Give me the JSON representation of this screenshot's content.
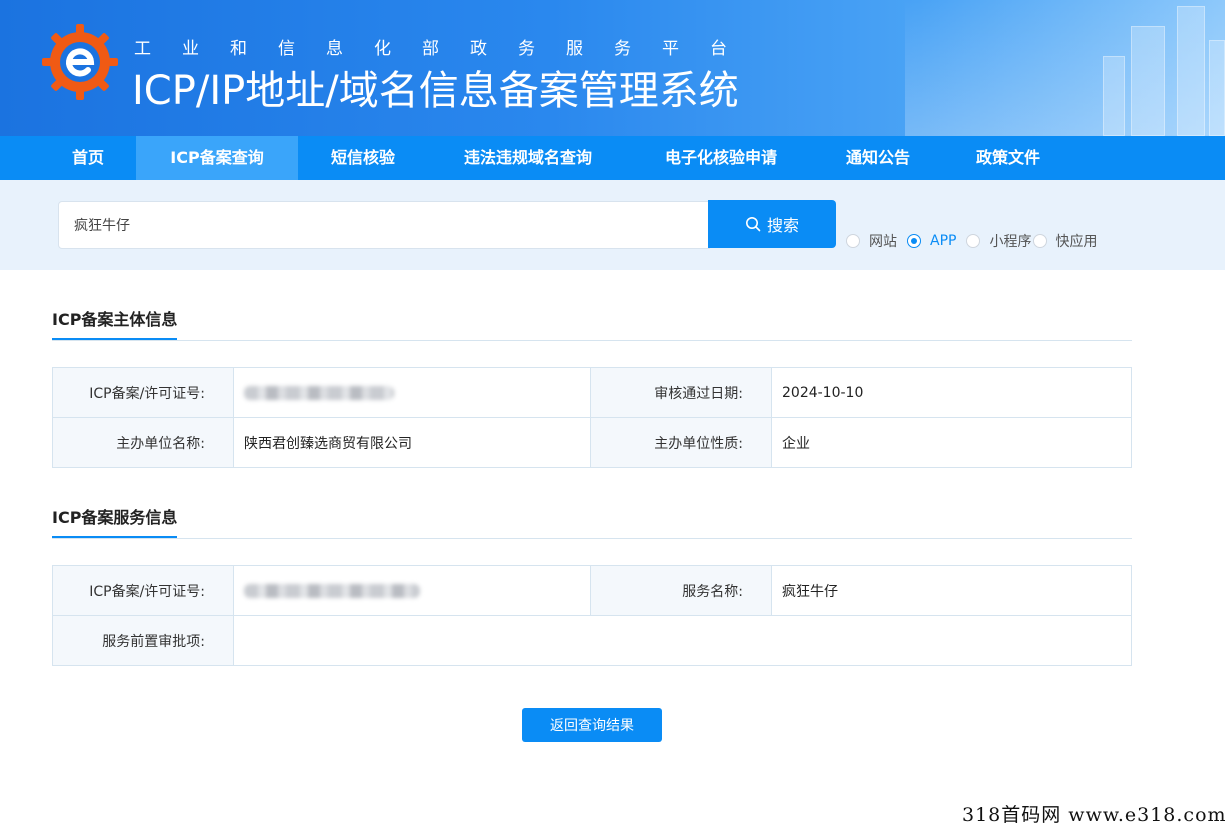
{
  "header": {
    "subtitle": "工业和信息化部政务服务平台",
    "title": "ICP/IP地址/域名信息备案管理系统",
    "brand_color": "#1b73e0"
  },
  "nav": {
    "items": [
      {
        "label": "首页"
      },
      {
        "label": "ICP备案查询",
        "active": true
      },
      {
        "label": "短信核验"
      },
      {
        "label": "违法违规域名查询"
      },
      {
        "label": "电子化核验申请"
      },
      {
        "label": "通知公告"
      },
      {
        "label": "政策文件"
      }
    ],
    "active_color": "#3aa5fa",
    "bar_color": "#0a8cf5"
  },
  "search": {
    "value": "疯狂牛仔",
    "button_label": "搜索",
    "button_icon": "search-icon",
    "types": [
      {
        "label": "网站",
        "checked": false
      },
      {
        "label": "APP",
        "checked": true
      },
      {
        "label": "小程序",
        "checked": false
      },
      {
        "label": "快应用",
        "checked": false
      }
    ]
  },
  "entity_section": {
    "title": "ICP备案主体信息",
    "rows": [
      {
        "k1": "ICP备案/许可证号:",
        "v1": "",
        "k2": "审核通过日期:",
        "v2": "2024-10-10"
      },
      {
        "k1": "主办单位名称:",
        "v1": "陕西君创臻选商贸有限公司",
        "k2": "主办单位性质:",
        "v2": "企业"
      }
    ]
  },
  "service_section": {
    "title": "ICP备案服务信息",
    "rows": [
      {
        "k1": "ICP备案/许可证号:",
        "v1": "",
        "k2": "服务名称:",
        "v2": "疯狂牛仔"
      },
      {
        "k1": "服务前置审批项:",
        "v1": ""
      }
    ]
  },
  "back_button": "返回查询结果",
  "watermark": "318首码网  www.e318.com"
}
